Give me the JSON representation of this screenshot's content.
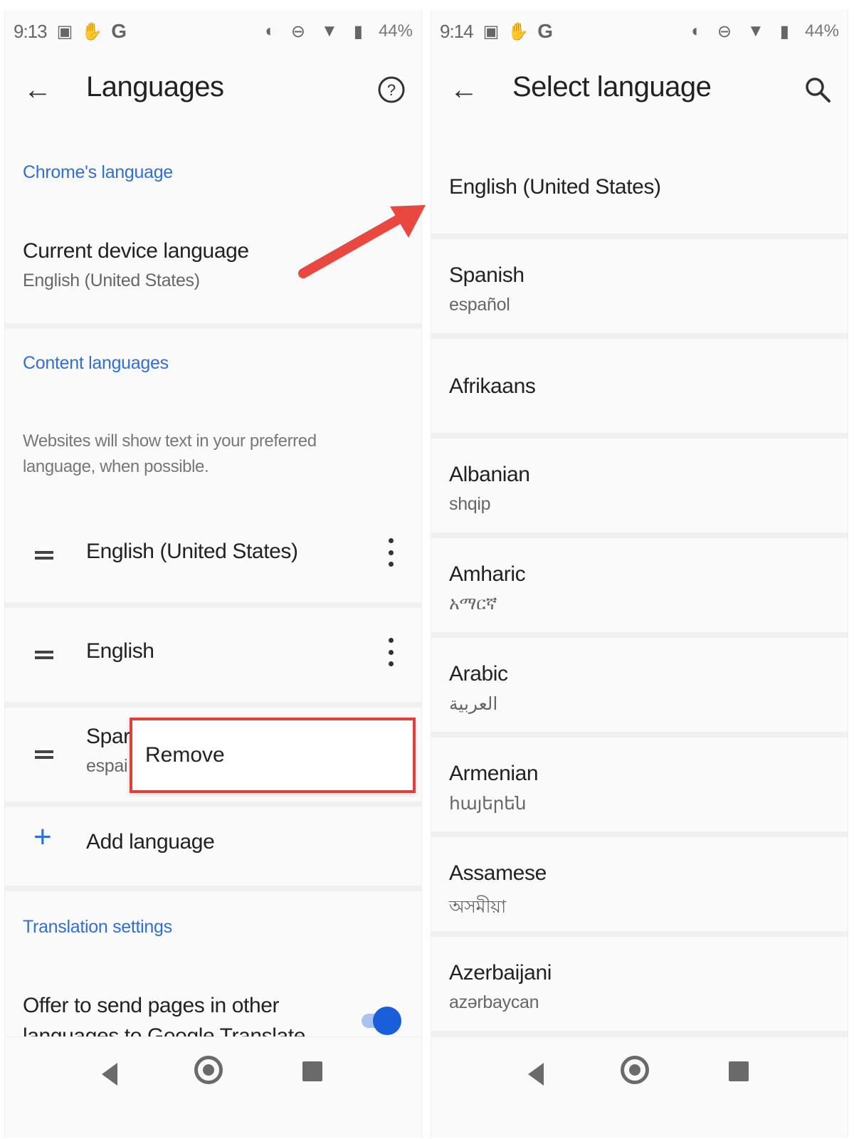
{
  "left": {
    "status": {
      "time": "9:13",
      "g": "G",
      "battery": "44%"
    },
    "title": "Languages",
    "chrome_language_header": "Chrome's language",
    "device_language": {
      "title": "Current device language",
      "value": "English (United States)"
    },
    "content_languages_header": "Content languages",
    "description": "Websites will show text in your preferred language, when possible.",
    "languages": [
      {
        "name": "English (United States)"
      },
      {
        "name": "English"
      },
      {
        "name": "Spar",
        "native": "espai"
      }
    ],
    "popup_remove": "Remove",
    "add_language": "Add language",
    "translation_header": "Translation settings",
    "offer_translate": "Offer to send pages in other",
    "offer_translate_cut": "languages to Google Translate"
  },
  "right": {
    "status": {
      "time": "9:14",
      "g": "G",
      "battery": "44%"
    },
    "title": "Select language",
    "list": [
      {
        "name": "English (United States)",
        "native": ""
      },
      {
        "name": "Spanish",
        "native": "español"
      },
      {
        "name": "Afrikaans",
        "native": ""
      },
      {
        "name": "Albanian",
        "native": "shqip"
      },
      {
        "name": "Amharic",
        "native": "አማርኛ"
      },
      {
        "name": "Arabic",
        "native": "العربية"
      },
      {
        "name": "Armenian",
        "native": "հայերեն"
      },
      {
        "name": "Assamese",
        "native": "অসমীয়া"
      },
      {
        "name": "Azerbaijani",
        "native": "azərbaycan"
      }
    ]
  },
  "colors": {
    "accent_blue": "#2f6fd6",
    "annotation_red": "#e0403a",
    "toggle_on": "#1a5fd9"
  },
  "icons": [
    "back-arrow-icon",
    "help-icon",
    "search-icon",
    "drag-handle-icon",
    "more-vert-icon",
    "plus-icon"
  ]
}
